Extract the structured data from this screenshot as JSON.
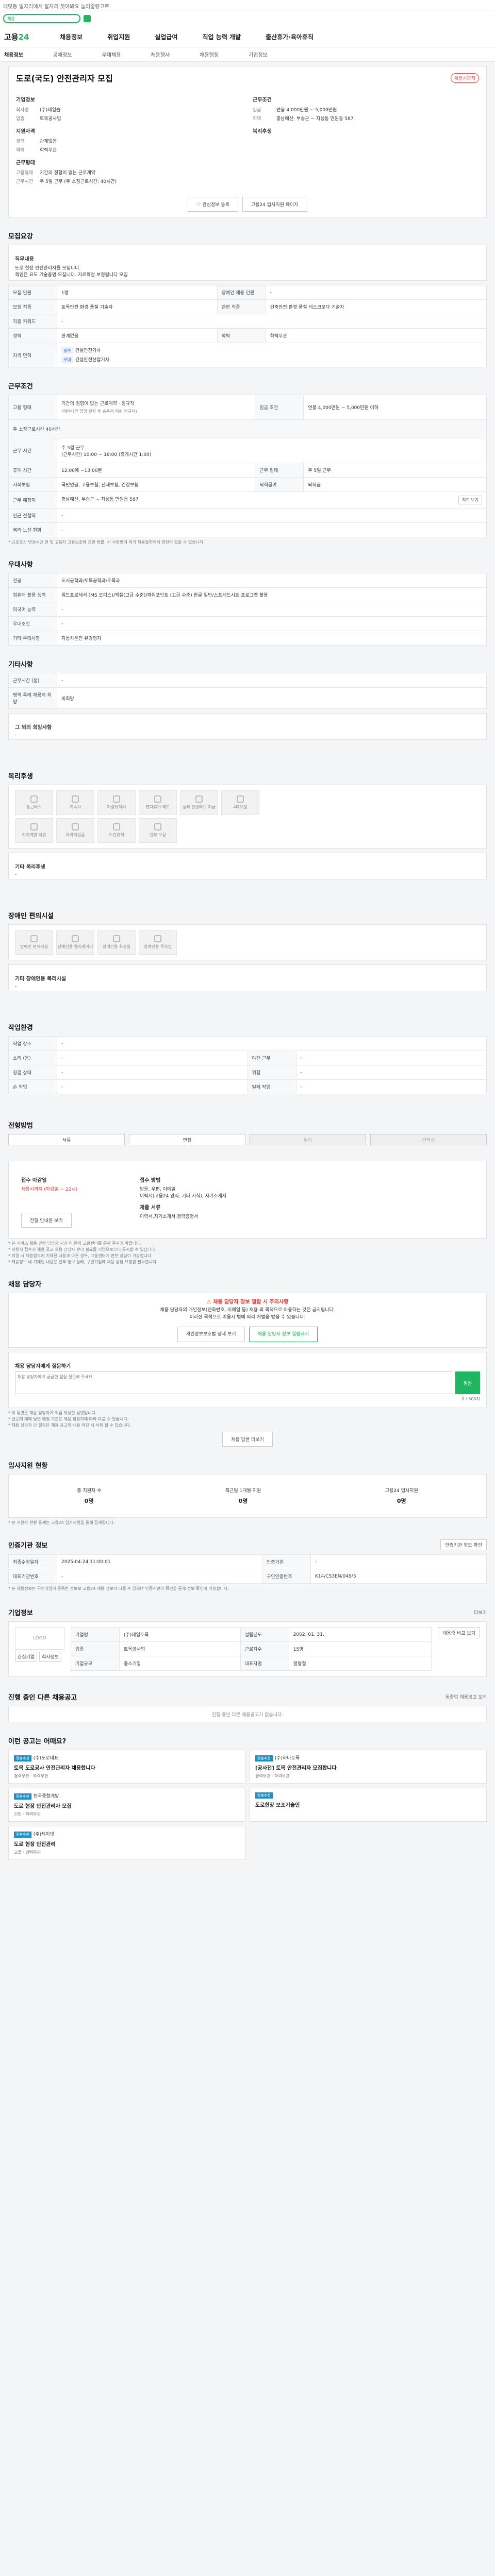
{
  "topbar": {
    "text": "레딧등 일자리에서 알자리 찾아봐요 눌러줄랑고로"
  },
  "search": {
    "placeholder": "채용"
  },
  "gnb": {
    "logo_a": "고용",
    "logo_b": "24",
    "items": [
      "채용정보",
      "취업지원",
      "실업급여",
      "직업 능력 개발",
      "출산휴가·육아휴직"
    ]
  },
  "lnb": {
    "items": [
      "채용정보",
      "공채정보",
      "우대채용",
      "채용행사",
      "채용행정",
      "기업정보"
    ]
  },
  "job": {
    "title": "도로(국도) 안전관리자 모집",
    "status_badge": "채용시까지",
    "company_h": "기업정보",
    "company_rows": [
      {
        "k": "회사명",
        "v": "(주)제일솔"
      },
      {
        "k": "업종",
        "v": "토목공사업"
      }
    ],
    "cond_h": "근무조건",
    "cond_rows": [
      {
        "k": "임금",
        "v": "연봉 4,000만원 ~ 5,000만원"
      },
      {
        "k": "지역",
        "v": "충남예산, 부송군 ~ 자성동 만원동 587"
      }
    ],
    "req_h": "지원자격",
    "req_rows": [
      {
        "k": "경력",
        "v": "관계없음"
      },
      {
        "k": "학력",
        "v": "학력무관"
      }
    ],
    "welfare_h": "복리후생",
    "worktype_h": "근무형태",
    "worktype_rows": [
      {
        "k": "고용형태",
        "v": "기간의 정함이 없는 근로계약"
      },
      {
        "k": "근무시간",
        "v": "주 5일 근무 (주 소정근로시간: 40시간)"
      }
    ],
    "btn_interest": "관심정보 등록",
    "btn_share": "고용24 입사지원 페이지"
  },
  "summary": {
    "title": "모집요강",
    "box_h": "직무내용",
    "lines": [
      "도로 현장 안전관리자를 모집니다.",
      "책임은 요도 기술증명 모집니다. 자료확정 보정됩니다 모집"
    ],
    "rows": [
      [
        "모집 인원",
        "1명",
        "장애인 채용 인원",
        "-"
      ],
      [
        "모집 직종",
        "토목안전 환경 품질 기술자",
        "관련 직종",
        "건축안전·환경 품질 테스크보다 기술자"
      ],
      [
        "직종 키워드",
        "-",
        "",
        ""
      ],
      [
        "경력",
        "관계없음",
        "학력",
        "학력무관"
      ]
    ],
    "license_k": "자격 면허",
    "licenses": [
      {
        "tag": "필수",
        "v": "건설안전기사"
      },
      {
        "tag": "우대",
        "v": "건설안전산업기사"
      }
    ]
  },
  "work": {
    "title": "근무조건",
    "type_k": "고용 형태",
    "type_v": "기간의 정함이 없는 근로계약 · 정규직",
    "type_note": "(해야니깐 임임 전환 후 승용적 직원 정규직)",
    "pay_k": "임금 조건",
    "pay_v": "연봉 4,000만원 ~ 5,000만원 이하",
    "pay_note": "주 소정근로시간 40시간",
    "time_k": "근무 시간",
    "time_v": "(근무시간) 10:00 ~ 18:00 (휴게시간 1:00)",
    "time_v2": "주 5일 근무",
    "rows": [
      [
        "휴게 시간",
        "12:00에 ~13:00분",
        "근무 형태",
        "주 5일 근무"
      ],
      [
        "사회보험",
        "국민연금, 고용보험, 산재보험, 건강보험",
        "퇴직급여",
        "퇴직금"
      ]
    ],
    "place_k": "근무 예정지",
    "place_v": "충남예산, 부송군 ~ 자성동 만원동 587",
    "place_btn": "지도 보기",
    "near_k": "인근 전철역",
    "near_v": "-",
    "smoke_k": "복리 노선 현황",
    "smoke_v": "-",
    "footnote": "* 근로조건 변경시엔 현 및 고용자 고용보조에 관한 법률, 시 사항법에 의거 채용절차에서 엔진이 있을 수 있습니다."
  },
  "prefer": {
    "title": "우대사항",
    "rows": [
      [
        "전공",
        "도시공학과/토목공학과/토목과"
      ],
      [
        "컴퓨터 활용 능력",
        "워드프로세서 (MS 오피스)/엑셀(고급 수준)/파워포인트 (고급 수준) 한글 일반/스프레드시트 프로그램 활용"
      ],
      [
        "외국어 능력",
        "-"
      ],
      [
        "우대조건",
        "-"
      ],
      [
        "기타 우대사항",
        "자동차운전 유경험자"
      ]
    ]
  },
  "etc": {
    "title": "기타사항",
    "rows": [
      [
        "근무시간 (점)",
        "-"
      ],
      [
        "병역 특례 채용의 희망",
        "비희망"
      ]
    ],
    "prefer_h": "그 외의 희망사항",
    "prefer_v": "-"
  },
  "welfare": {
    "title": "복리후생",
    "icons": [
      "통근버스",
      "기숙사",
      "차량유지비",
      "연차휴가 제도",
      "성과 인센티브 지급",
      "4대보험",
      "자기계발 지원",
      "육아지원금",
      "보건휴직",
      "간부 보상",
      "",
      ""
    ],
    "other_h": "기타 복리후생",
    "other_v": "-"
  },
  "disability": {
    "title": "장애인 편의시설",
    "icons": [
      "장애인 편의시설",
      "장애인용 엘리베이터",
      "장애인용 화장실",
      "장애인용 주차장"
    ],
    "other_h": "기타 장애인용 복리시설",
    "other_v": "-"
  },
  "env": {
    "title": "작업환경",
    "rows": [
      [
        "작업 장소",
        "-",
        "",
        ""
      ],
      [
        "소리 (음)",
        "-",
        "야간 근무",
        "-"
      ],
      [
        "청결 상태",
        "-",
        "위험",
        "-"
      ],
      [
        "손 작업",
        "-",
        "밀폐 작업",
        "-"
      ]
    ]
  },
  "apply": {
    "title": "전형방법",
    "tabs": [
      "서류",
      "면접",
      "필기",
      "인적성"
    ],
    "period_h": "접수 마감일",
    "period_v": "채용시까지 (마감일 ~ 22시)",
    "method_h": "접수 방법",
    "method_v1": "방문, 우편, 이메일",
    "method_v2": "이력서(고용24 양식, 기타 서식), 자기소개서",
    "docs_h": "제출 서류",
    "docs_v": "이력서,자기소개서,경력증명서",
    "guide_btn": "전형 안내문 보기",
    "notes": [
      "* 본 서비스 채용 안정 담당자 시기 이 문의 고용센터를 통해 주시기 바랍니다.",
      "* 지원서 접수시 채용 공고 채용 담당자 관리 필요를 기업으로부터 통지할 수 있습니다.",
      "* 지원 시 채용정보에 기재된 내용과 다른 경우, 고용센터에 관련 상담이 가능합니다.",
      "* 채용정보 내 기재된 내용은 일부 정보 상태, 구인기업에 채용 상담 요청할 필요합니다."
    ]
  },
  "contact": {
    "title": "채용 담당자",
    "alert": "채용 담당자 정보 열람 시 주의사항",
    "alert_body1": "채용 담당자의 개인정보(전화번호, 이메일 등) 채용 외 목적으로 이용하는 것은 금지됩니다.",
    "alert_body2": "이러한 목적으로 이용시 법에 따라 처벌을 받을 수 있습니다.",
    "btn_1": "개인정보보호법 상세 보기",
    "btn_2": "채용 담당자 정보 열람하기",
    "qa_h": "채용 담당자에게 질문하기",
    "qa_placeholder": "채용 담당자에게 궁금한 점을 질문해 주세요.",
    "qa_send": "질문",
    "qa_count": "0 / 500자",
    "notes": [
      "* 이 답변은 채용 담당자가 직접 작성한 답변입니다.",
      "* 질문에 대해 답변 예정 기간은 채용 담당자에 따라 다를 수 있습니다.",
      "* 채용 담당자 간 질문은 채용 공고의 내용 마감 시 삭제 될 수 있습니다."
    ],
    "more_btn": "채용 답변 더보기"
  },
  "stats": {
    "title": "입사지원 현황",
    "items": [
      {
        "label": "총 지원자 수",
        "v": "0명"
      },
      {
        "label": "최근일 1개월 지원",
        "v": "0명"
      },
      {
        "label": "고용24 입사지원",
        "v": "0명"
      }
    ],
    "note": "* 본 지원자 현황 통계는 고용24 입사지원을 통해 집계됩니다."
  },
  "reg": {
    "title": "인증기관 정보",
    "btn": "인증기관 정보 확인",
    "rows": [
      [
        "최종수정일자",
        "2025-04-24 11:00:01",
        "인증기관",
        "-"
      ],
      [
        "대표기관번호",
        "-",
        "구인인증번호",
        "K14/CS3EN/049/3"
      ]
    ],
    "notes": [
      "* 본 채용정보는 구인기업이 등록한 정보로 고용24 채용 정보와 다를 수 있으며 인증기관의 확인을 통해 정보 확인이 가능합니다."
    ]
  },
  "company": {
    "title": "기업정보",
    "more": "더보기",
    "logo": "LOGO",
    "btn_a": "관심기업",
    "btn_b": "회사정보",
    "rows": [
      [
        "기업명",
        "(주)제일토목",
        "설립년도",
        "2002. 01. 31."
      ],
      [
        "업종",
        "토목공사업",
        "근로자수",
        "15명"
      ],
      [
        "기업규모",
        "중소기업",
        "대표자명",
        "정형철"
      ]
    ],
    "btn_more": "채용중 비교 보기"
  },
  "others": {
    "title": "진행 중인 다른 채용공고",
    "link": "동종업 채용공고 보기",
    "empty": "진행 중인 다른 채용공고가 없습니다."
  },
  "recommend": {
    "title": "이런 공고는 어때요?",
    "items": [
      {
        "badge": "맞춤추천",
        "co": "(주)도로대표",
        "name": "토목 도로공사 안전관리자 채용합니다",
        "m1": "경력무관",
        "m2": "학력무관"
      },
      {
        "badge": "맞춤추천",
        "co": "(주)하나토목",
        "name": "[공사전] 토목 안전관리자 모집합니다",
        "m1": "경력무관",
        "m2": "학력무관"
      },
      {
        "badge": "맞춤추천",
        "co": "한국종합개발",
        "name": "도로 현장 안전관리자 모집",
        "m1": "신입",
        "m2": "학력무관"
      },
      {
        "badge": "맞춤추천",
        "co": "",
        "name": "도로현장 보조기술인",
        "m1": "",
        "m2": ""
      },
      {
        "badge": "맞춤추천",
        "co": "(주)제이넷",
        "name": "도로 현장 안전관리",
        "m1": "고졸",
        "m2": "경력무관"
      }
    ]
  }
}
